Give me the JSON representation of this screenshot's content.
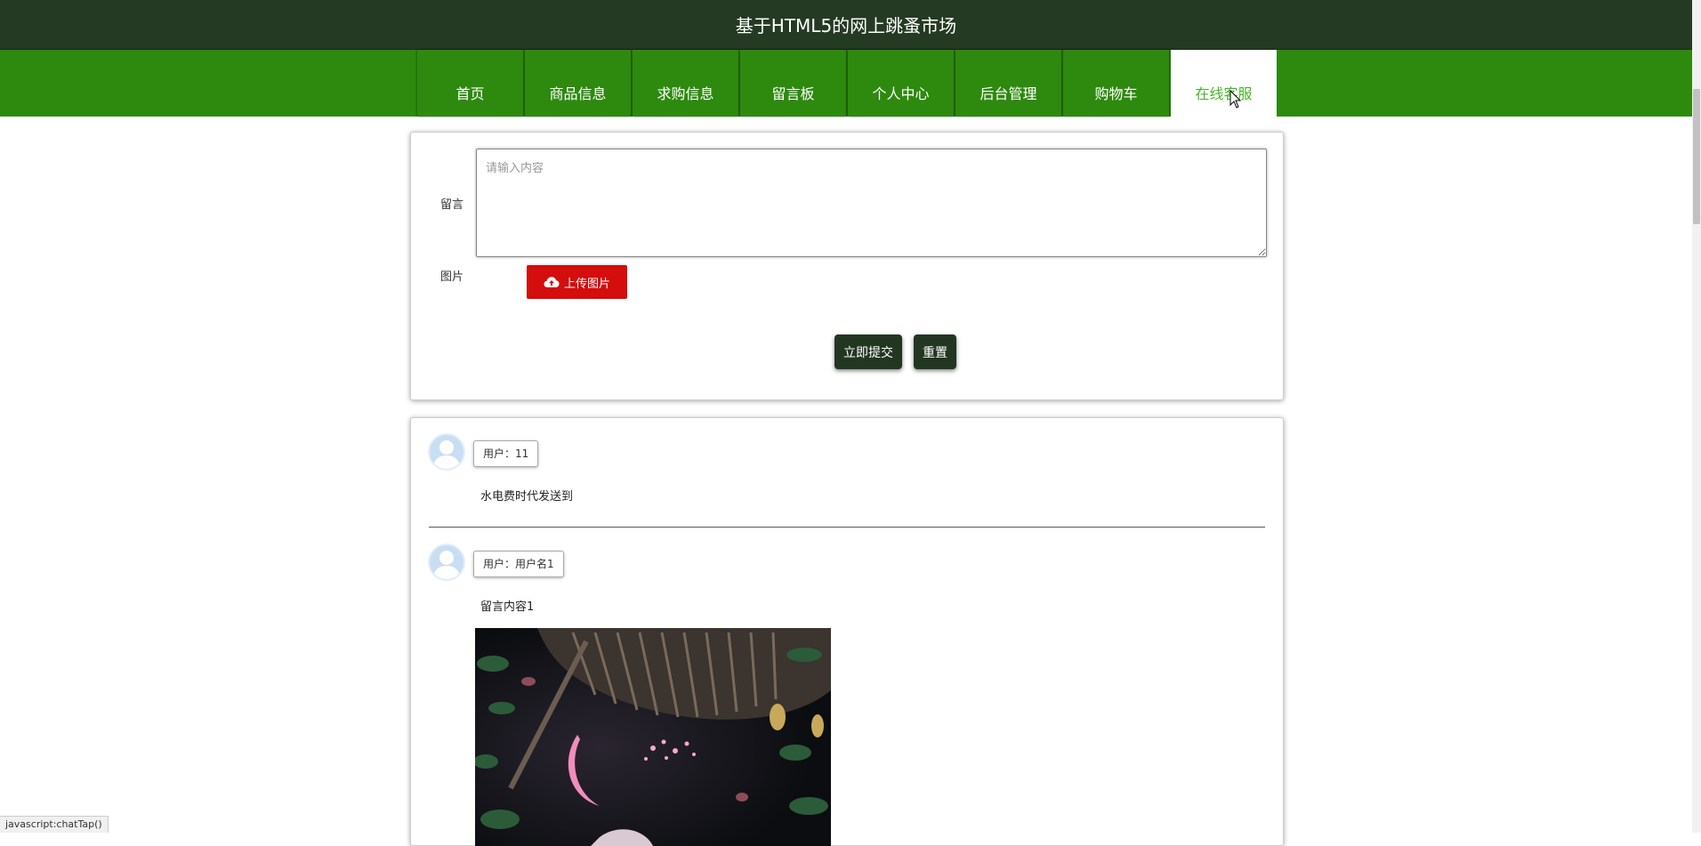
{
  "header": {
    "title": "基于HTML5的网上跳蚤市场"
  },
  "nav": {
    "items": [
      {
        "label": "首页",
        "active": false
      },
      {
        "label": "商品信息",
        "active": false
      },
      {
        "label": "求购信息",
        "active": false
      },
      {
        "label": "留言板",
        "active": false
      },
      {
        "label": "个人中心",
        "active": false
      },
      {
        "label": "后台管理",
        "active": false
      },
      {
        "label": "购物车",
        "active": false
      },
      {
        "label": "在线客服",
        "active": true
      }
    ]
  },
  "form": {
    "message_label": "留言",
    "message_placeholder": "请输入内容",
    "image_label": "图片",
    "upload_label": "上传图片",
    "submit_label": "立即提交",
    "reset_label": "重置"
  },
  "messages": [
    {
      "user": "用户：11",
      "content": "水电费时代发送到"
    },
    {
      "user": "用户：用户名1",
      "content": "留言内容1"
    }
  ],
  "status_bar": {
    "text": "javascript:chatTap()"
  },
  "colors": {
    "topbar": "#243a22",
    "nav": "#2e890f",
    "active_text": "#48b32a",
    "upload_button": "#d40d0d",
    "dark_button": "#233622"
  }
}
